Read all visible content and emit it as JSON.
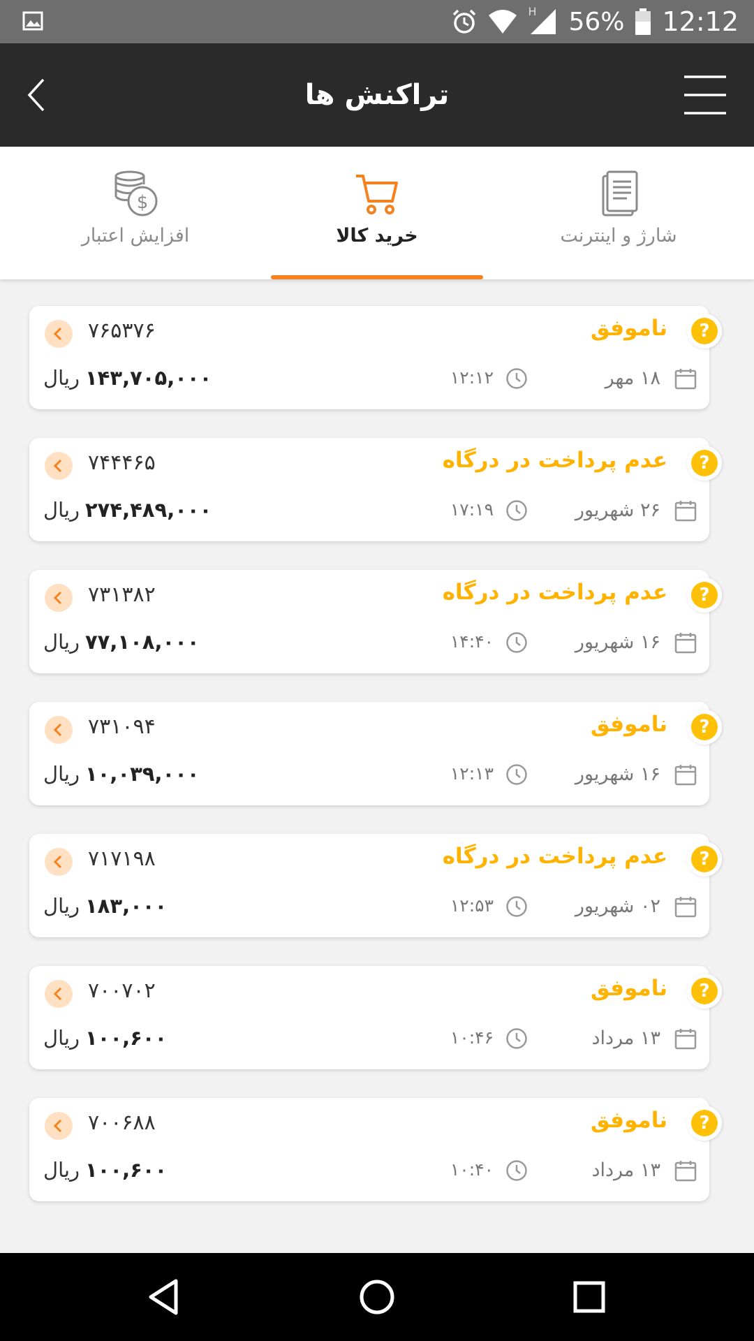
{
  "status_bar": {
    "battery": "56%",
    "time": "12:12",
    "network": "H"
  },
  "app_bar": {
    "title": "تراکنش ها"
  },
  "tabs": [
    {
      "label": "شارژ و اینترنت",
      "icon": "receipt-icon",
      "active": false
    },
    {
      "label": "خرید کالا",
      "icon": "cart-icon",
      "active": true
    },
    {
      "label": "افزایش اعتبار",
      "icon": "coins-icon",
      "active": false
    }
  ],
  "colors": {
    "accent": "#f5821f",
    "warning": "#ffc107",
    "status_text": "#ffb300",
    "app_bar": "#2a2a2a"
  },
  "currency_label": "ریال",
  "transactions": [
    {
      "status": "ناموفق",
      "id": "۷۶۵۳۷۶",
      "date": "۱۸ مهر",
      "time": "۱۲:۱۲",
      "amount": "۱۴۳,۷۰۵,۰۰۰"
    },
    {
      "status": "عدم پرداخت در درگاه",
      "id": "۷۴۴۴۶۵",
      "date": "۲۶ شهریور",
      "time": "۱۷:۱۹",
      "amount": "۲۷۴,۴۸۹,۰۰۰"
    },
    {
      "status": "عدم پرداخت در درگاه",
      "id": "۷۳۱۳۸۲",
      "date": "۱۶ شهریور",
      "time": "۱۴:۴۰",
      "amount": "۷۷,۱۰۸,۰۰۰"
    },
    {
      "status": "ناموفق",
      "id": "۷۳۱۰۹۴",
      "date": "۱۶ شهریور",
      "time": "۱۲:۱۳",
      "amount": "۱۰,۰۳۹,۰۰۰"
    },
    {
      "status": "عدم پرداخت در درگاه",
      "id": "۷۱۷۱۹۸",
      "date": "۰۲ شهریور",
      "time": "۱۲:۵۳",
      "amount": "۱۸۳,۰۰۰"
    },
    {
      "status": "ناموفق",
      "id": "۷۰۰۷۰۲",
      "date": "۱۳ مرداد",
      "time": "۱۰:۴۶",
      "amount": "۱۰۰,۶۰۰"
    },
    {
      "status": "ناموفق",
      "id": "۷۰۰۶۸۸",
      "date": "۱۳ مرداد",
      "time": "۱۰:۴۰",
      "amount": "۱۰۰,۶۰۰"
    }
  ]
}
